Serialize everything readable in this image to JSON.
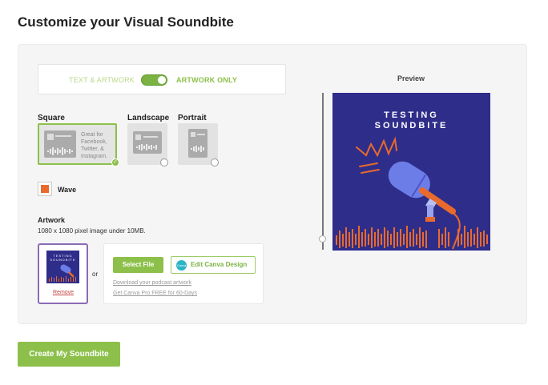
{
  "page": {
    "title": "Customize your Visual Soundbite"
  },
  "toggle": {
    "left_label": "TEXT & ARTWORK",
    "right_label": "ARTWORK ONLY",
    "state": "artwork-only"
  },
  "formats": {
    "square": {
      "label": "Square",
      "description_lines": [
        "Great for",
        "Facebook,",
        "Twitter, &",
        "Instagram."
      ],
      "selected": true
    },
    "landscape": {
      "label": "Landscape",
      "selected": false
    },
    "portrait": {
      "label": "Portrait",
      "selected": false
    }
  },
  "wave": {
    "label": "Wave",
    "color": "#e86a2c"
  },
  "artwork": {
    "title": "Artwork",
    "subtitle": "1080 x 1080 pixel image under 10MB.",
    "remove_label": "Remove",
    "or_label": "or",
    "select_file_label": "Select File",
    "canva_label": "Edit Canva Design",
    "canva_logo_text": "Canva",
    "download_link": "Download your podcast artwork",
    "canva_pro_link": "Get Canva Pro FREE for 60-Days",
    "thumb_title_lines": [
      "TESTING",
      "SOUNDBITE"
    ]
  },
  "preview": {
    "label": "Preview",
    "title_lines": [
      "TESTING",
      "SOUNDBITE"
    ],
    "background": "#2f2d8a",
    "accent": "#e86a2c"
  },
  "create_button": {
    "label": "Create My Soundbite"
  },
  "colors": {
    "brand_green": "#8cc04a",
    "selected_purple": "#8b6bb5"
  }
}
